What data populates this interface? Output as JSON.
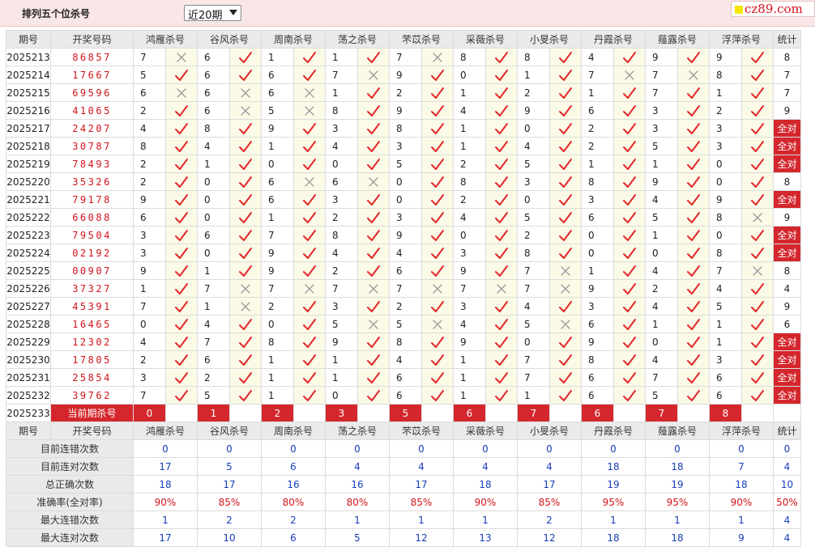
{
  "title": "排列五个位杀号",
  "period_select": {
    "value": "近20期"
  },
  "brand": {
    "text": "cz89.com",
    "colors": {
      "brand": "#d2141c",
      "accent": "#f5e600"
    }
  },
  "colors": {
    "check": "#e3262b",
    "cross": "#9a9a9a",
    "red_bg": "#d4272d",
    "cell_bg": "#fbfae6"
  },
  "header": {
    "issue": "期号",
    "numbers": "开奖号码",
    "methods": [
      "鸿雁杀号",
      "谷风杀号",
      "周南杀号",
      "荡之杀号",
      "芣苡杀号",
      "采薇杀号",
      "小旻杀号",
      "丹霞杀号",
      "薤露杀号",
      "浮萍杀号"
    ],
    "count": "统计"
  },
  "rows": [
    {
      "issue": "2025213",
      "numbers": "86857",
      "kills": [
        [
          7,
          0
        ],
        [
          6,
          1
        ],
        [
          1,
          1
        ],
        [
          1,
          1
        ],
        [
          7,
          0
        ],
        [
          8,
          1
        ],
        [
          8,
          1
        ],
        [
          4,
          1
        ],
        [
          9,
          1
        ],
        [
          9,
          1
        ]
      ],
      "count": "8"
    },
    {
      "issue": "2025214",
      "numbers": "17667",
      "kills": [
        [
          5,
          1
        ],
        [
          6,
          1
        ],
        [
          6,
          1
        ],
        [
          7,
          0
        ],
        [
          9,
          1
        ],
        [
          0,
          1
        ],
        [
          1,
          1
        ],
        [
          7,
          0
        ],
        [
          7,
          0
        ],
        [
          8,
          1
        ]
      ],
      "count": "7"
    },
    {
      "issue": "2025215",
      "numbers": "69596",
      "kills": [
        [
          6,
          0
        ],
        [
          6,
          0
        ],
        [
          6,
          0
        ],
        [
          1,
          1
        ],
        [
          2,
          1
        ],
        [
          1,
          1
        ],
        [
          2,
          1
        ],
        [
          1,
          1
        ],
        [
          7,
          1
        ],
        [
          1,
          1
        ]
      ],
      "count": "7"
    },
    {
      "issue": "2025216",
      "numbers": "41065",
      "kills": [
        [
          2,
          1
        ],
        [
          6,
          0
        ],
        [
          5,
          0
        ],
        [
          8,
          1
        ],
        [
          9,
          1
        ],
        [
          4,
          1
        ],
        [
          9,
          1
        ],
        [
          6,
          1
        ],
        [
          3,
          1
        ],
        [
          2,
          1
        ]
      ],
      "count": "9"
    },
    {
      "issue": "2025217",
      "numbers": "24207",
      "kills": [
        [
          4,
          1
        ],
        [
          8,
          1
        ],
        [
          9,
          1
        ],
        [
          3,
          1
        ],
        [
          8,
          1
        ],
        [
          1,
          1
        ],
        [
          0,
          1
        ],
        [
          2,
          1
        ],
        [
          3,
          1
        ],
        [
          3,
          1
        ]
      ],
      "count": "全对"
    },
    {
      "issue": "2025218",
      "numbers": "30787",
      "kills": [
        [
          8,
          1
        ],
        [
          4,
          1
        ],
        [
          1,
          1
        ],
        [
          4,
          1
        ],
        [
          3,
          1
        ],
        [
          1,
          1
        ],
        [
          4,
          1
        ],
        [
          2,
          1
        ],
        [
          5,
          1
        ],
        [
          3,
          1
        ]
      ],
      "count": "全对"
    },
    {
      "issue": "2025219",
      "numbers": "78493",
      "kills": [
        [
          2,
          1
        ],
        [
          1,
          1
        ],
        [
          0,
          1
        ],
        [
          0,
          1
        ],
        [
          5,
          1
        ],
        [
          2,
          1
        ],
        [
          5,
          1
        ],
        [
          1,
          1
        ],
        [
          1,
          1
        ],
        [
          0,
          1
        ]
      ],
      "count": "全对"
    },
    {
      "issue": "2025220",
      "numbers": "35326",
      "kills": [
        [
          2,
          1
        ],
        [
          0,
          1
        ],
        [
          6,
          0
        ],
        [
          6,
          0
        ],
        [
          0,
          1
        ],
        [
          8,
          1
        ],
        [
          3,
          1
        ],
        [
          8,
          1
        ],
        [
          9,
          1
        ],
        [
          0,
          1
        ]
      ],
      "count": "8"
    },
    {
      "issue": "2025221",
      "numbers": "79178",
      "kills": [
        [
          9,
          1
        ],
        [
          0,
          1
        ],
        [
          6,
          1
        ],
        [
          3,
          1
        ],
        [
          0,
          1
        ],
        [
          2,
          1
        ],
        [
          0,
          1
        ],
        [
          3,
          1
        ],
        [
          4,
          1
        ],
        [
          9,
          1
        ]
      ],
      "count": "全对"
    },
    {
      "issue": "2025222",
      "numbers": "66088",
      "kills": [
        [
          6,
          1
        ],
        [
          0,
          1
        ],
        [
          1,
          1
        ],
        [
          2,
          1
        ],
        [
          3,
          1
        ],
        [
          4,
          1
        ],
        [
          5,
          1
        ],
        [
          6,
          1
        ],
        [
          5,
          1
        ],
        [
          8,
          0
        ]
      ],
      "count": "9"
    },
    {
      "issue": "2025223",
      "numbers": "79504",
      "kills": [
        [
          3,
          1
        ],
        [
          6,
          1
        ],
        [
          7,
          1
        ],
        [
          8,
          1
        ],
        [
          9,
          1
        ],
        [
          0,
          1
        ],
        [
          2,
          1
        ],
        [
          0,
          1
        ],
        [
          1,
          1
        ],
        [
          0,
          1
        ]
      ],
      "count": "全对"
    },
    {
      "issue": "2025224",
      "numbers": "02192",
      "kills": [
        [
          3,
          1
        ],
        [
          0,
          1
        ],
        [
          9,
          1
        ],
        [
          4,
          1
        ],
        [
          4,
          1
        ],
        [
          3,
          1
        ],
        [
          8,
          1
        ],
        [
          0,
          1
        ],
        [
          0,
          1
        ],
        [
          8,
          1
        ]
      ],
      "count": "全对"
    },
    {
      "issue": "2025225",
      "numbers": "00907",
      "kills": [
        [
          9,
          1
        ],
        [
          1,
          1
        ],
        [
          9,
          1
        ],
        [
          2,
          1
        ],
        [
          6,
          1
        ],
        [
          9,
          1
        ],
        [
          7,
          0
        ],
        [
          1,
          1
        ],
        [
          4,
          1
        ],
        [
          7,
          0
        ]
      ],
      "count": "8"
    },
    {
      "issue": "2025226",
      "numbers": "37327",
      "kills": [
        [
          1,
          1
        ],
        [
          7,
          0
        ],
        [
          7,
          0
        ],
        [
          7,
          0
        ],
        [
          7,
          0
        ],
        [
          7,
          0
        ],
        [
          7,
          0
        ],
        [
          9,
          1
        ],
        [
          2,
          1
        ],
        [
          4,
          1
        ]
      ],
      "count": "4"
    },
    {
      "issue": "2025227",
      "numbers": "45391",
      "kills": [
        [
          7,
          1
        ],
        [
          1,
          0
        ],
        [
          2,
          1
        ],
        [
          3,
          1
        ],
        [
          2,
          1
        ],
        [
          3,
          1
        ],
        [
          4,
          1
        ],
        [
          3,
          1
        ],
        [
          4,
          1
        ],
        [
          5,
          1
        ]
      ],
      "count": "9"
    },
    {
      "issue": "2025228",
      "numbers": "16465",
      "kills": [
        [
          0,
          1
        ],
        [
          4,
          1
        ],
        [
          0,
          1
        ],
        [
          5,
          0
        ],
        [
          5,
          0
        ],
        [
          4,
          1
        ],
        [
          5,
          0
        ],
        [
          6,
          1
        ],
        [
          1,
          1
        ],
        [
          1,
          1
        ]
      ],
      "count": "6"
    },
    {
      "issue": "2025229",
      "numbers": "12302",
      "kills": [
        [
          4,
          1
        ],
        [
          7,
          1
        ],
        [
          8,
          1
        ],
        [
          9,
          1
        ],
        [
          8,
          1
        ],
        [
          9,
          1
        ],
        [
          0,
          1
        ],
        [
          9,
          1
        ],
        [
          0,
          1
        ],
        [
          1,
          1
        ]
      ],
      "count": "全对"
    },
    {
      "issue": "2025230",
      "numbers": "17805",
      "kills": [
        [
          2,
          1
        ],
        [
          6,
          1
        ],
        [
          1,
          1
        ],
        [
          1,
          1
        ],
        [
          4,
          1
        ],
        [
          1,
          1
        ],
        [
          7,
          1
        ],
        [
          8,
          1
        ],
        [
          4,
          1
        ],
        [
          3,
          1
        ]
      ],
      "count": "全对"
    },
    {
      "issue": "2025231",
      "numbers": "25854",
      "kills": [
        [
          3,
          1
        ],
        [
          2,
          1
        ],
        [
          1,
          1
        ],
        [
          1,
          1
        ],
        [
          6,
          1
        ],
        [
          1,
          1
        ],
        [
          7,
          1
        ],
        [
          6,
          1
        ],
        [
          7,
          1
        ],
        [
          6,
          1
        ]
      ],
      "count": "全对"
    },
    {
      "issue": "2025232",
      "numbers": "39762",
      "kills": [
        [
          7,
          1
        ],
        [
          5,
          1
        ],
        [
          1,
          1
        ],
        [
          0,
          1
        ],
        [
          6,
          1
        ],
        [
          1,
          1
        ],
        [
          1,
          1
        ],
        [
          6,
          1
        ],
        [
          5,
          1
        ],
        [
          6,
          1
        ]
      ],
      "count": "全对"
    }
  ],
  "current": {
    "issue": "2025233",
    "label": "当前期杀号",
    "kills": [
      "0",
      "1",
      "2",
      "3",
      "5",
      "6",
      "7",
      "6",
      "7",
      "8"
    ]
  },
  "stats": [
    {
      "label": "目前连错次数",
      "values": [
        "0",
        "0",
        "0",
        "0",
        "0",
        "0",
        "0",
        "0",
        "0",
        "0",
        "0"
      ],
      "red": false
    },
    {
      "label": "目前连对次数",
      "values": [
        "17",
        "5",
        "6",
        "4",
        "4",
        "4",
        "4",
        "18",
        "18",
        "7",
        "4"
      ],
      "red": false
    },
    {
      "label": "总正确次数",
      "values": [
        "18",
        "17",
        "16",
        "16",
        "17",
        "18",
        "17",
        "19",
        "19",
        "18",
        "10"
      ],
      "red": false
    },
    {
      "label": "准确率(全对率)",
      "values": [
        "90%",
        "85%",
        "80%",
        "80%",
        "85%",
        "90%",
        "85%",
        "95%",
        "95%",
        "90%",
        "50%"
      ],
      "red": true
    },
    {
      "label": "最大连错次数",
      "values": [
        "1",
        "2",
        "2",
        "1",
        "1",
        "1",
        "2",
        "1",
        "1",
        "1",
        "4"
      ],
      "red": false
    },
    {
      "label": "最大连对次数",
      "values": [
        "17",
        "10",
        "6",
        "5",
        "12",
        "13",
        "12",
        "18",
        "18",
        "9",
        "4"
      ],
      "red": false
    }
  ]
}
